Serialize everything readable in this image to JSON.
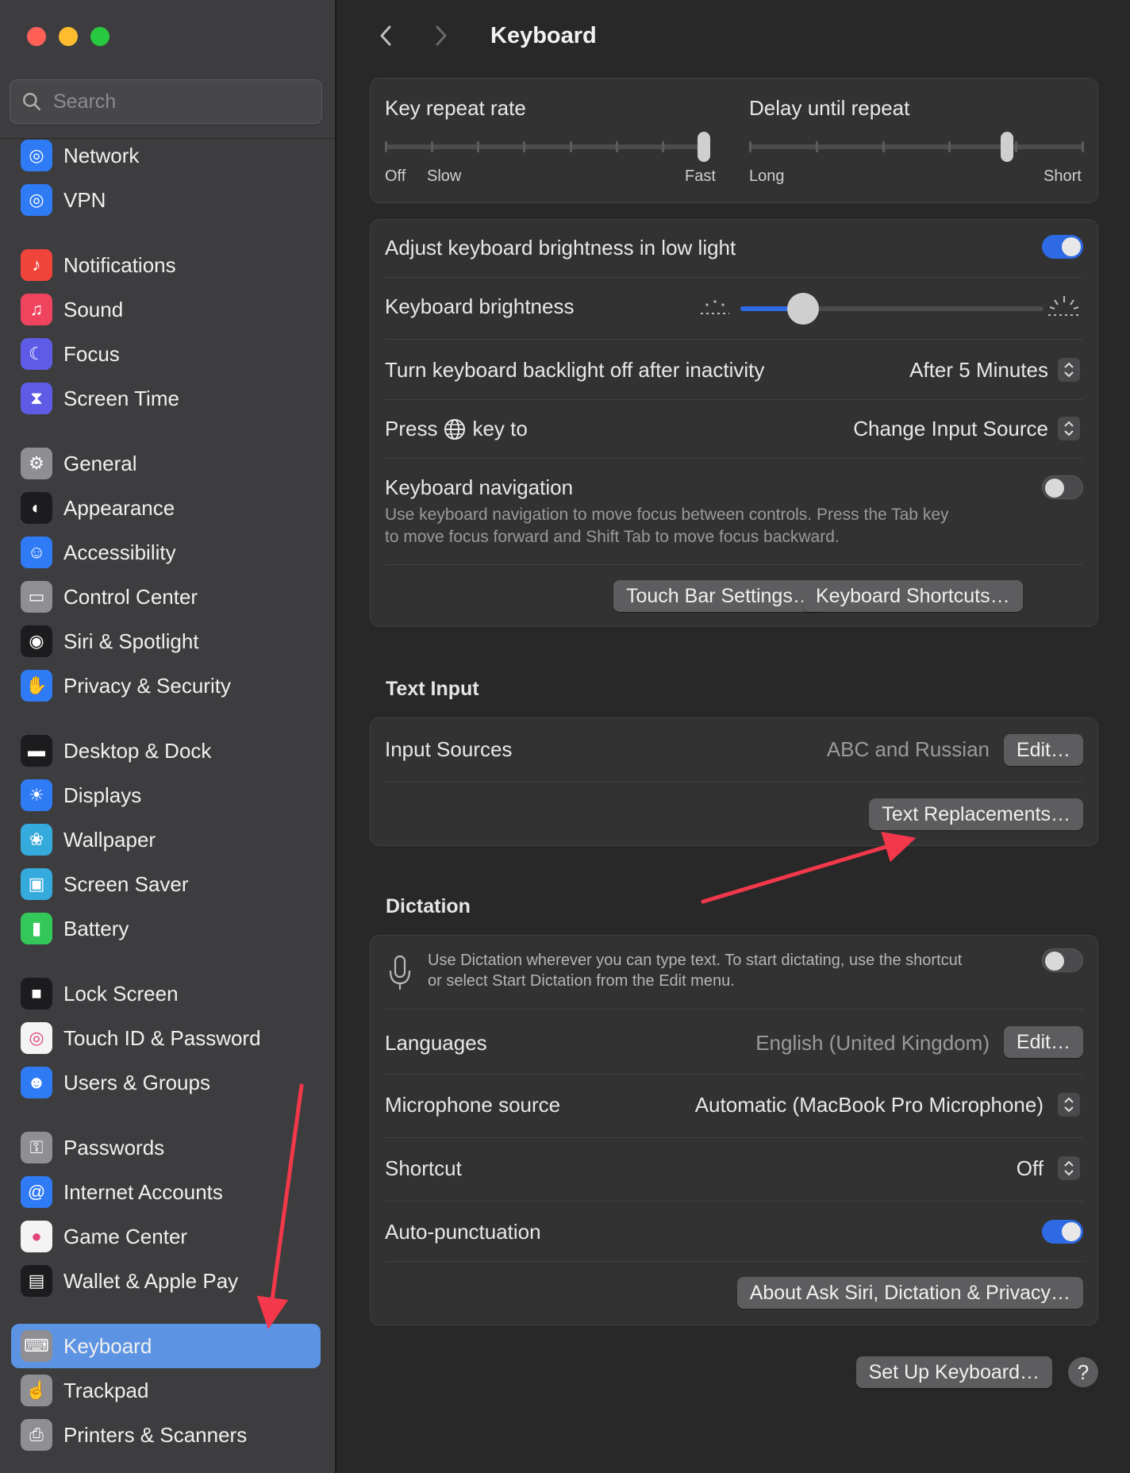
{
  "sidebar": {
    "search_placeholder": "Search",
    "items": [
      {
        "label": "Network",
        "icon": "globe-icon",
        "color": "#2f7bf5"
      },
      {
        "label": "VPN",
        "icon": "globe-icon",
        "color": "#2f7bf5"
      },
      {
        "label": "Notifications",
        "icon": "bell-icon",
        "color": "#f0443a"
      },
      {
        "label": "Sound",
        "icon": "speaker-icon",
        "color": "#f0445e"
      },
      {
        "label": "Focus",
        "icon": "moon-icon",
        "color": "#5e5ce6"
      },
      {
        "label": "Screen Time",
        "icon": "hourglass-icon",
        "color": "#5e5ce6"
      },
      {
        "label": "General",
        "icon": "gear-icon",
        "color": "#8e8e93"
      },
      {
        "label": "Appearance",
        "icon": "appearance-icon",
        "color": "#1c1c1e"
      },
      {
        "label": "Accessibility",
        "icon": "accessibility-icon",
        "color": "#2f7bf5"
      },
      {
        "label": "Control Center",
        "icon": "toggles-icon",
        "color": "#8e8e93"
      },
      {
        "label": "Siri & Spotlight",
        "icon": "siri-icon",
        "color": "#1c1c1e"
      },
      {
        "label": "Privacy & Security",
        "icon": "hand-icon",
        "color": "#2f7bf5"
      },
      {
        "label": "Desktop & Dock",
        "icon": "dock-icon",
        "color": "#1c1c1e"
      },
      {
        "label": "Displays",
        "icon": "sun-icon",
        "color": "#2f7bf5"
      },
      {
        "label": "Wallpaper",
        "icon": "flower-icon",
        "color": "#35aadc"
      },
      {
        "label": "Screen Saver",
        "icon": "screensaver-icon",
        "color": "#35aadc"
      },
      {
        "label": "Battery",
        "icon": "battery-icon",
        "color": "#34c759"
      },
      {
        "label": "Lock Screen",
        "icon": "lock-icon",
        "color": "#1c1c1e"
      },
      {
        "label": "Touch ID & Password",
        "icon": "fingerprint-icon",
        "color": "#f4f4f4"
      },
      {
        "label": "Users & Groups",
        "icon": "users-icon",
        "color": "#2f7bf5"
      },
      {
        "label": "Passwords",
        "icon": "key-icon",
        "color": "#8e8e93"
      },
      {
        "label": "Internet Accounts",
        "icon": "at-icon",
        "color": "#2f7bf5"
      },
      {
        "label": "Game Center",
        "icon": "game-center-icon",
        "color": "#f4f4f4"
      },
      {
        "label": "Wallet & Apple Pay",
        "icon": "wallet-icon",
        "color": "#1c1c1e"
      },
      {
        "label": "Keyboard",
        "icon": "keyboard-icon",
        "color": "#8e8e93"
      },
      {
        "label": "Trackpad",
        "icon": "trackpad-icon",
        "color": "#8e8e93"
      },
      {
        "label": "Printers & Scanners",
        "icon": "printer-icon",
        "color": "#8e8e93"
      }
    ]
  },
  "header": {
    "title": "Keyboard"
  },
  "repeat": {
    "key_repeat_label": "Key repeat rate",
    "key_repeat_min": "Off",
    "key_repeat_slow": "Slow",
    "key_repeat_max": "Fast",
    "key_repeat_value": 1.0,
    "delay_label": "Delay until repeat",
    "delay_min": "Long",
    "delay_max": "Short",
    "delay_value": 0.78
  },
  "backlight": {
    "adjust_label": "Adjust keyboard brightness in low light",
    "adjust_on": true,
    "brightness_label": "Keyboard brightness",
    "brightness_value": 0.15,
    "inactivity_label": "Turn keyboard backlight off after inactivity",
    "inactivity_value": "After 5 Minutes",
    "press_key_label_prefix": "Press",
    "press_key_label_suffix": "key to",
    "press_key_value": "Change Input Source",
    "nav_label": "Keyboard navigation",
    "nav_desc_line1": "Use keyboard navigation to move focus between controls. Press the Tab key",
    "nav_desc_line2": "to move focus forward and Shift Tab to move focus backward.",
    "nav_on": false,
    "touchbar_button": "Touch Bar Settings…",
    "shortcuts_button": "Keyboard Shortcuts…"
  },
  "text_input": {
    "section_title": "Text Input",
    "input_sources_label": "Input Sources",
    "input_sources_value": "ABC and Russian",
    "edit_button": "Edit…",
    "replacements_button": "Text Replacements…"
  },
  "dictation": {
    "section_title": "Dictation",
    "desc_line1": "Use Dictation wherever you can type text. To start dictating, use the shortcut",
    "desc_line2": "or select Start Dictation from the Edit menu.",
    "enabled": false,
    "languages_label": "Languages",
    "languages_value": "English (United Kingdom)",
    "edit_button": "Edit…",
    "mic_label": "Microphone source",
    "mic_value": "Automatic (MacBook Pro Microphone)",
    "shortcut_label": "Shortcut",
    "shortcut_value": "Off",
    "autopunct_label": "Auto-punctuation",
    "autopunct_on": true,
    "about_button": "About Ask Siri, Dictation & Privacy…"
  },
  "footer": {
    "setup_button": "Set Up Keyboard…",
    "help_label": "?"
  },
  "colors": {
    "accent": "#2f6ae5",
    "selected_sidebar": "#5c93e3",
    "annotation_arrow": "#f2384a"
  }
}
